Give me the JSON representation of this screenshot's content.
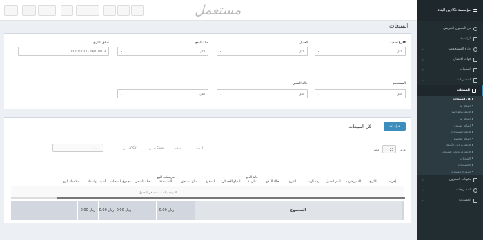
{
  "topbar": {
    "items": [
      "",
      "",
      "",
      "",
      ""
    ],
    "watermark": "مستعمل"
  },
  "sidebar": {
    "company": "مؤسسة ذكاءين البناء",
    "items": [
      {
        "label": "من المحتوى التعريفي"
      },
      {
        "label": "الرئيسية"
      },
      {
        "label": "إدارة المستخدمين"
      },
      {
        "label": "جهات الاتصال"
      },
      {
        "label": "المنتجات"
      },
      {
        "label": "المشتريات"
      },
      {
        "label": "المبيعات",
        "active": true
      }
    ],
    "subitems": [
      {
        "label": "كل المبيعات",
        "current": true
      },
      {
        "label": "إضافة بيع"
      },
      {
        "label": "قائمة نقاط البيع"
      },
      {
        "label": "إضافة بيع"
      },
      {
        "label": "إضافة مسودة"
      },
      {
        "label": "قائمة المسودات"
      },
      {
        "label": "إضافة التحصيل"
      },
      {
        "label": "قائمة عروض الأسعار"
      },
      {
        "label": "قائمة مرتجعات المبيعات"
      },
      {
        "label": "الشحنات"
      },
      {
        "label": "الخصومات"
      },
      {
        "label": "استيراد المبيعات"
      }
    ],
    "bottom": [
      {
        "label": "مكونات المخزون"
      },
      {
        "label": "المصروفات"
      },
      {
        "label": "الحسابات"
      }
    ]
  },
  "page": {
    "title": "المبيعات"
  },
  "filters": {
    "header": "التصفية",
    "location_label": "الفرع",
    "location_value": "الكل",
    "customer_label": "العميل",
    "customer_value": "الكل",
    "payment_label": "حالة الدفع",
    "payment_value": "الكل",
    "date_label": "نطاق التاريخ",
    "date_value": "01/01/2023 - 09/07/2023",
    "user_label": "المستخدم",
    "user_value": "الكل",
    "shipping_label": "حالة الشحن",
    "shipping_value": "الكل",
    "extra_value": "الكل"
  },
  "sales": {
    "title": "كل المبيعات",
    "add_label": "إضافة +",
    "show_label": "عرض",
    "show_count": "25",
    "entries_label": "عنصر",
    "export_csv": "تصدير CSV",
    "export_excel": "تصدير Excel",
    "print": "طباعة",
    "columns_label": "أعمدة",
    "search_placeholder": "بحث ..."
  },
  "table": {
    "columns": [
      "إجراء",
      "التاريخ",
      "الفاتورة رقم",
      "اسم العميل",
      "رقم الهاتف",
      "الفرع",
      "حالة الدفع",
      "حالة الدفع طريقة",
      "المبلغ الإجمالي",
      "المدفوع",
      "مبلغ مستحق",
      "مرتجعات البيع المستحقة",
      "حالة الشحن",
      "مجموع المنتجات",
      "أضيف بواسطة",
      "ملاحظة البيع"
    ],
    "empty_message": "لا توجد بيانات متاحة في الجدول",
    "footer_label": "المجموع",
    "footer_values": [
      "0.00 ريال",
      "0.00 ريال",
      "0.00 ريال",
      "0.00 ريال"
    ]
  }
}
